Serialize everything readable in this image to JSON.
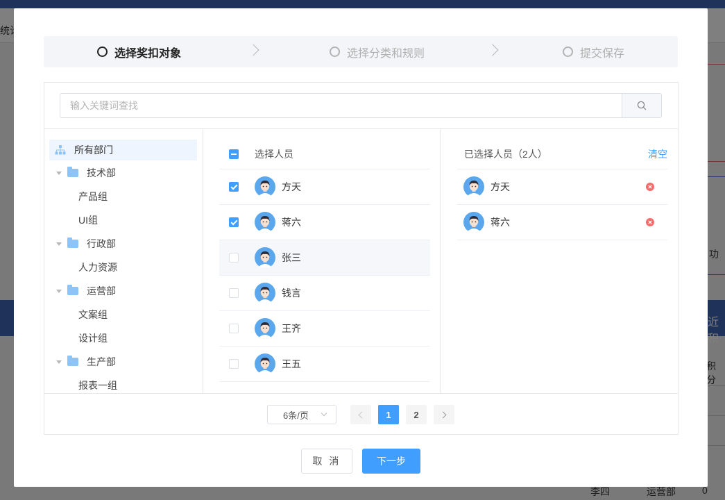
{
  "background": {
    "nav_text": "统计",
    "band_text": "近积",
    "side_text_1": "功",
    "side_text_2": "积分",
    "bottom_name": "李四",
    "bottom_dept": "运营部",
    "bottom_value": "0"
  },
  "steps": [
    {
      "label": "选择奖扣对象",
      "state": "active"
    },
    {
      "label": "选择分类和规则",
      "state": "inactive"
    },
    {
      "label": "提交保存",
      "state": "inactive"
    }
  ],
  "search": {
    "placeholder": "输入关键词查找",
    "value": "",
    "icon": "search-icon"
  },
  "tree": {
    "root": "所有部门",
    "departments": [
      {
        "name": "技术部",
        "groups": [
          "产品组",
          "UI组"
        ]
      },
      {
        "name": "行政部",
        "groups": [
          "人力资源"
        ]
      },
      {
        "name": "运营部",
        "groups": [
          "文案组",
          "设计组"
        ]
      },
      {
        "name": "生产部",
        "groups": [
          "报表一组"
        ]
      }
    ]
  },
  "people": {
    "header": "选择人员",
    "select_all_state": "indeterminate",
    "rows": [
      {
        "name": "方天",
        "checked": true
      },
      {
        "name": "蒋六",
        "checked": true
      },
      {
        "name": "张三",
        "checked": false
      },
      {
        "name": "钱言",
        "checked": false
      },
      {
        "name": "王齐",
        "checked": false
      },
      {
        "name": "王五",
        "checked": false
      }
    ]
  },
  "selected": {
    "header": "已选择人员（2人）",
    "clear_label": "清空",
    "rows": [
      {
        "name": "方天"
      },
      {
        "name": "蒋六"
      }
    ]
  },
  "pagination": {
    "page_size_label": "6条/页",
    "pages": [
      "1",
      "2"
    ],
    "current_page": "1"
  },
  "footer": {
    "cancel_label": "取 消",
    "next_label": "下一步"
  },
  "colors": {
    "primary": "#409eff",
    "remove": "#f56c6c",
    "folder": "#8cc4f7",
    "header_blue": "#3f64b5"
  }
}
